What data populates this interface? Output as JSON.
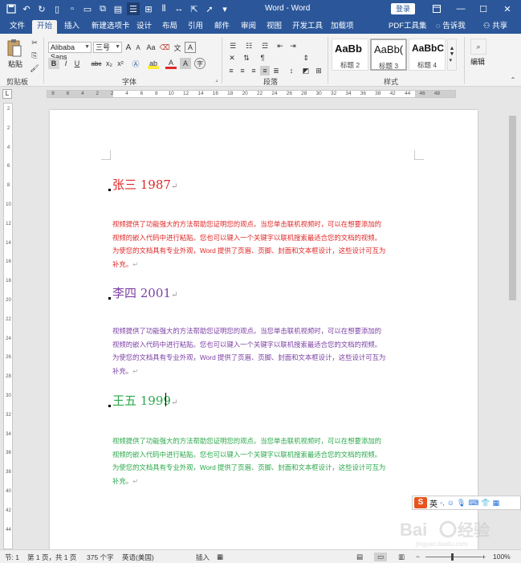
{
  "window": {
    "title": "Word - Word",
    "login_label": "登录"
  },
  "menu": {
    "tabs": [
      "文件",
      "开始",
      "插入",
      "新建选项卡",
      "设计",
      "布局",
      "引用",
      "邮件",
      "审阅",
      "视图",
      "开发工具",
      "加载项",
      "PDF工具集"
    ],
    "tell_me": "告诉我",
    "share": "共享"
  },
  "ribbon": {
    "clipboard": {
      "paste_label": "粘贴",
      "group_label": "剪贴板"
    },
    "font": {
      "font_name": "Alibaba Sans",
      "font_size": "三号",
      "grow": "A",
      "shrink": "A",
      "aa_label": "Aa",
      "group_label": "字体",
      "bold": "B",
      "italic": "I",
      "underline": "U",
      "strike": "abc",
      "sub": "x₂",
      "sup": "x²",
      "color_a": "A",
      "highlight": "ab",
      "char_border": "A",
      "circle_char": "字"
    },
    "paragraph": {
      "group_label": "段落"
    },
    "styles": {
      "items": [
        {
          "sample": "AaBb",
          "name": "标题 2"
        },
        {
          "sample": "AaBb(",
          "name": "标题 3"
        },
        {
          "sample": "AaBbC",
          "name": "标题 4"
        }
      ],
      "group_label": "样式"
    },
    "editing": {
      "label": "编辑"
    }
  },
  "ruler": {
    "tab_selector": "L",
    "numbers": [
      "8",
      "6",
      "4",
      "2",
      "2",
      "4",
      "6",
      "8",
      "10",
      "12",
      "14",
      "16",
      "18",
      "20",
      "22",
      "24",
      "26",
      "28",
      "30",
      "32",
      "34",
      "36",
      "38",
      "42",
      "44",
      "46",
      "48"
    ]
  },
  "vruler": {
    "numbers": [
      "2",
      "2",
      "4",
      "6",
      "8",
      "10",
      "12",
      "14",
      "16",
      "18",
      "20",
      "22",
      "24",
      "26",
      "28",
      "30",
      "32",
      "34",
      "36",
      "38",
      "40",
      "42",
      "44"
    ]
  },
  "document": {
    "sections": [
      {
        "heading": "张三 1987",
        "color": "#e02727",
        "lines": [
          "视频提供了功能强大的方法帮助您证明您的观点。当您单击联机视频时，可以在想要添加的",
          "视频的嵌入代码中进行粘贴。您也可以键入一个关键字以联机搜索最适合您的文档的视频。",
          "为使您的文档具有专业外观，Word 提供了页眉、页脚、封面和文本框设计，这些设计可互为",
          "补充。"
        ]
      },
      {
        "heading": "李四 2001",
        "color": "#7b3fa3",
        "lines": [
          "视频提供了功能强大的方法帮助您证明您的观点。当您单击联机视频时，可以在想要添加的",
          "视频的嵌入代码中进行粘贴。您也可以键入一个关键字以联机搜索最适合您的文档的视频。",
          "为使您的文档具有专业外观，Word 提供了页眉、页脚、封面和文本框设计，这些设计可互为",
          "补充。"
        ]
      },
      {
        "heading": "王五 1999",
        "color": "#2aa84a",
        "lines": [
          "视频提供了功能强大的方法帮助您证明您的观点。当您单击联机视频时，可以在想要添加的",
          "视频的嵌入代码中进行粘贴。您也可以键入一个关键字以联机搜索最适合您的文档的视频。",
          "为使您的文档具有专业外观，Word 提供了页眉、页脚、封面和文本框设计，这些设计可互为",
          "补充。"
        ]
      }
    ],
    "para_mark": "↵"
  },
  "ime": {
    "logo": "S",
    "lang": "英"
  },
  "statusbar": {
    "section": "节: 1",
    "page": "第 1 页，共 1 页",
    "words": "375 个字",
    "lang": "英语(美国)",
    "mode": "插入",
    "zoom": "100%"
  },
  "colors": {
    "titlebar": "#2b579a",
    "ribbon": "#f3f3f3",
    "workspace": "#e6e6e6"
  }
}
